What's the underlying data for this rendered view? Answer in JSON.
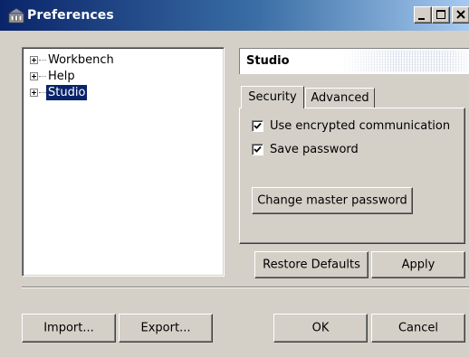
{
  "window": {
    "title": "Preferences",
    "icon": "preferences-icon"
  },
  "titlebar_buttons": [
    "minimize-icon",
    "maximize-icon",
    "close-icon"
  ],
  "tree": {
    "items": [
      {
        "label": "Workbench",
        "expanded": false,
        "selected": false
      },
      {
        "label": "Help",
        "expanded": false,
        "selected": false
      },
      {
        "label": "Studio",
        "expanded": false,
        "selected": true
      }
    ]
  },
  "page": {
    "title": "Studio",
    "tabs": [
      {
        "label": "Security",
        "active": true
      },
      {
        "label": "Advanced",
        "active": false
      }
    ],
    "options": [
      {
        "label": "Use encrypted communication",
        "checked": true
      },
      {
        "label": "Save password",
        "checked": true
      }
    ],
    "change_master_password_label": "Change master password",
    "restore_defaults_label": "Restore Defaults",
    "apply_label": "Apply"
  },
  "footer": {
    "import_label": "Import...",
    "export_label": "Export...",
    "ok_label": "OK",
    "cancel_label": "Cancel"
  },
  "colors": {
    "titlebar_start": "#0a246a",
    "titlebar_end": "#a6caf0",
    "face": "#d4d0c8",
    "selection": "#0a246a"
  }
}
